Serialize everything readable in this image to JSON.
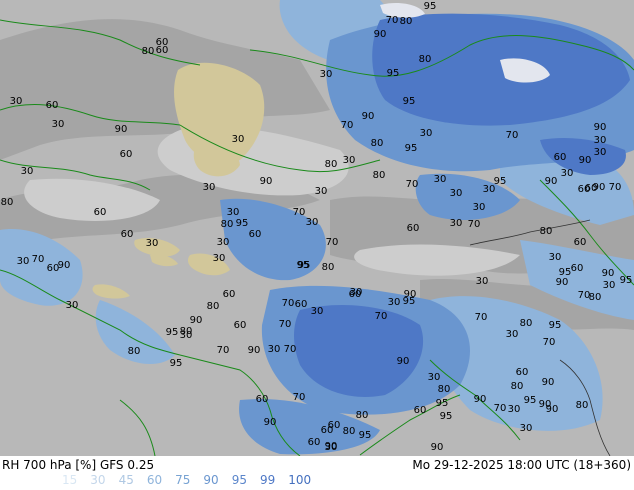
{
  "footer": {
    "title": "RH 700 hPa [%] GFS 0.25",
    "datetime": "Mo 29-12-2025 18:00 UTC (18+360)"
  },
  "legend": [
    {
      "value": "15",
      "color": "#d9e7f3"
    },
    {
      "value": "30",
      "color": "#c3d6ea"
    },
    {
      "value": "45",
      "color": "#afc8e3"
    },
    {
      "value": "60",
      "color": "#8fb4db"
    },
    {
      "value": "75",
      "color": "#78a3d3"
    },
    {
      "value": "90",
      "color": "#6a96cf"
    },
    {
      "value": "95",
      "color": "#5b86cb"
    },
    {
      "value": "99",
      "color": "#4e78c6"
    },
    {
      "value": "100",
      "color": "#4470bf"
    }
  ],
  "contour_labels": [
    "95",
    "70",
    "80",
    "90",
    "80",
    "60",
    "80",
    "60",
    "30",
    "95",
    "30",
    "60",
    "30",
    "90",
    "95",
    "70",
    "90",
    "80",
    "30",
    "30",
    "60",
    "80",
    "95",
    "70",
    "90",
    "30",
    "30",
    "30",
    "60",
    "90",
    "30",
    "90",
    "30",
    "80",
    "70",
    "30",
    "95",
    "90",
    "60",
    "30",
    "80",
    "60",
    "30",
    "30",
    "30",
    "70",
    "30",
    "30",
    "60",
    "90",
    "70",
    "80",
    "95",
    "60",
    "30",
    "30",
    "60",
    "70",
    "60",
    "30",
    "80",
    "70",
    "30",
    "60",
    "30",
    "70",
    "90",
    "80",
    "30",
    "90",
    "95",
    "30",
    "60",
    "30",
    "60",
    "90",
    "95",
    "60",
    "30",
    "95",
    "70",
    "60",
    "30",
    "70",
    "30",
    "70",
    "60",
    "70",
    "90",
    "80",
    "95",
    "30",
    "95",
    "30",
    "80",
    "90",
    "60",
    "70",
    "95",
    "80",
    "80",
    "95",
    "30",
    "70",
    "90",
    "60",
    "80",
    "70",
    "90",
    "30",
    "95",
    "70",
    "30",
    "90",
    "80",
    "30",
    "80",
    "95",
    "90",
    "70",
    "95",
    "70",
    "90",
    "90",
    "80",
    "95",
    "90",
    "80",
    "30",
    "60",
    "80",
    "60",
    "90",
    "30",
    "90",
    "95",
    "60",
    "30",
    "60",
    "60",
    "90"
  ]
}
